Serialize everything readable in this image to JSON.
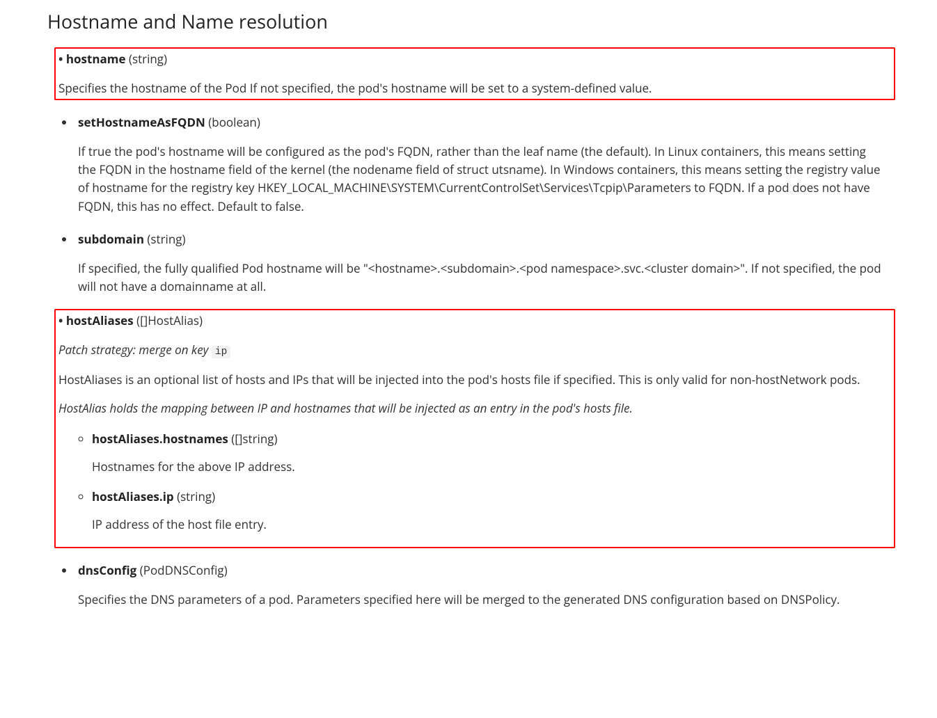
{
  "section": {
    "title": "Hostname and Name resolution"
  },
  "fields": {
    "hostname": {
      "name": "hostname",
      "type": "(string)",
      "desc": "Specifies the hostname of the Pod If not specified, the pod's hostname will be set to a system-defined value."
    },
    "setHostnameAsFQDN": {
      "name": "setHostnameAsFQDN",
      "type": "(boolean)",
      "desc": "If true the pod's hostname will be configured as the pod's FQDN, rather than the leaf name (the default). In Linux containers, this means setting the FQDN in the hostname field of the kernel (the nodename field of struct utsname). In Windows containers, this means setting the registry value of hostname for the registry key HKEY_LOCAL_MACHINE\\SYSTEM\\CurrentControlSet\\Services\\Tcpip\\Parameters to FQDN. If a pod does not have FQDN, this has no effect. Default to false."
    },
    "subdomain": {
      "name": "subdomain",
      "type": "(string)",
      "desc": "If specified, the fully qualified Pod hostname will be \"<hostname>.<subdomain>.<pod namespace>.svc.<cluster domain>\". If not specified, the pod will not have a domainname at all."
    },
    "hostAliases": {
      "name": "hostAliases",
      "type": "([]HostAlias)",
      "patch_prefix": "Patch strategy: merge on key ",
      "patch_key": "ip",
      "desc": "HostAliases is an optional list of hosts and IPs that will be injected into the pod's hosts file if specified. This is only valid for non-hostNetwork pods.",
      "subdesc": "HostAlias holds the mapping between IP and hostnames that will be injected as an entry in the pod's hosts file.",
      "children": {
        "hostnames": {
          "name": "hostAliases.hostnames",
          "type": "([]string)",
          "desc": "Hostnames for the above IP address."
        },
        "ip": {
          "name": "hostAliases.ip",
          "type": "(string)",
          "desc": "IP address of the host file entry."
        }
      }
    },
    "dnsConfig": {
      "name": "dnsConfig",
      "type": "(PodDNSConfig)",
      "desc": "Specifies the DNS parameters of a pod. Parameters specified here will be merged to the generated DNS configuration based on DNSPolicy."
    }
  }
}
